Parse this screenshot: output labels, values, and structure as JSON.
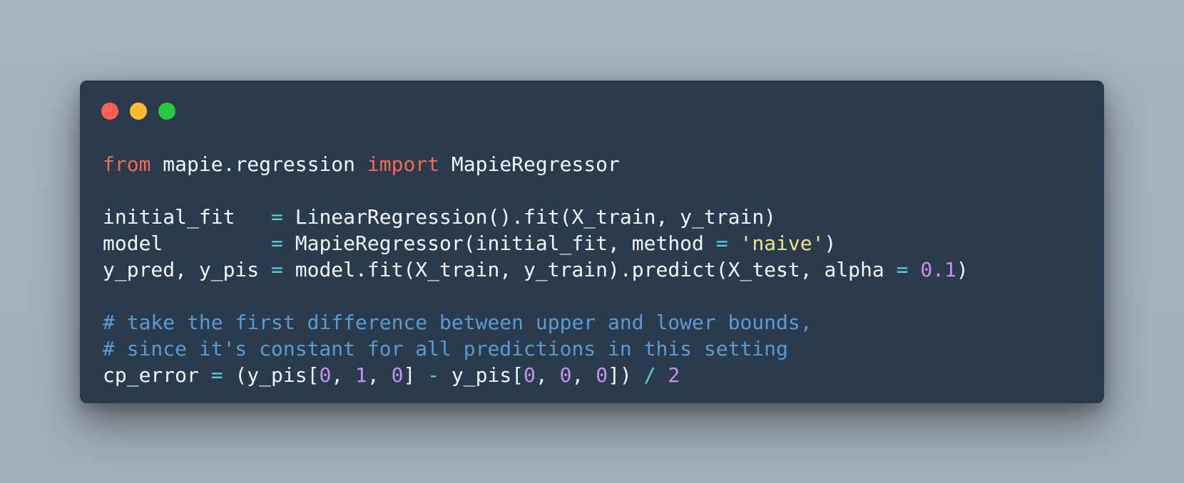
{
  "window": {
    "controls": [
      {
        "name": "close",
        "color": "#ff5f57"
      },
      {
        "name": "minimize",
        "color": "#febc2e"
      },
      {
        "name": "zoom",
        "color": "#28c840"
      }
    ],
    "background": "#2a3b4e"
  },
  "code": {
    "lines": [
      [
        {
          "text": "from",
          "type": "keyword"
        },
        {
          "text": " mapie.regression ",
          "type": "plain"
        },
        {
          "text": "import",
          "type": "keyword"
        },
        {
          "text": " MapieRegressor",
          "type": "plain"
        }
      ],
      [],
      [
        {
          "text": "initial_fit   ",
          "type": "plain"
        },
        {
          "text": "=",
          "type": "operator"
        },
        {
          "text": " LinearRegression().fit(X_train, y_train)",
          "type": "plain"
        }
      ],
      [
        {
          "text": "model         ",
          "type": "plain"
        },
        {
          "text": "=",
          "type": "operator"
        },
        {
          "text": " MapieRegressor(initial_fit, method ",
          "type": "plain"
        },
        {
          "text": "=",
          "type": "operator"
        },
        {
          "text": " ",
          "type": "plain"
        },
        {
          "text": "'naive'",
          "type": "string"
        },
        {
          "text": ")",
          "type": "plain"
        }
      ],
      [
        {
          "text": "y_pred, y_pis ",
          "type": "plain"
        },
        {
          "text": "=",
          "type": "operator"
        },
        {
          "text": " model.fit(X_train, y_train).predict(X_test, alpha ",
          "type": "plain"
        },
        {
          "text": "=",
          "type": "operator"
        },
        {
          "text": " ",
          "type": "plain"
        },
        {
          "text": "0.1",
          "type": "number"
        },
        {
          "text": ")",
          "type": "plain"
        }
      ],
      [],
      [
        {
          "text": "# take the first difference between upper and lower bounds,",
          "type": "comment"
        }
      ],
      [
        {
          "text": "# since it's constant for all predictions in this setting",
          "type": "comment"
        }
      ],
      [
        {
          "text": "cp_error ",
          "type": "plain"
        },
        {
          "text": "=",
          "type": "operator"
        },
        {
          "text": " (y_pis[",
          "type": "plain"
        },
        {
          "text": "0",
          "type": "number"
        },
        {
          "text": ", ",
          "type": "plain"
        },
        {
          "text": "1",
          "type": "number"
        },
        {
          "text": ", ",
          "type": "plain"
        },
        {
          "text": "0",
          "type": "number"
        },
        {
          "text": "] ",
          "type": "plain"
        },
        {
          "text": "-",
          "type": "operator"
        },
        {
          "text": " y_pis[",
          "type": "plain"
        },
        {
          "text": "0",
          "type": "number"
        },
        {
          "text": ", ",
          "type": "plain"
        },
        {
          "text": "0",
          "type": "number"
        },
        {
          "text": ", ",
          "type": "plain"
        },
        {
          "text": "0",
          "type": "number"
        },
        {
          "text": "]) ",
          "type": "plain"
        },
        {
          "text": "/",
          "type": "operator"
        },
        {
          "text": " ",
          "type": "plain"
        },
        {
          "text": "2",
          "type": "number"
        }
      ]
    ]
  }
}
